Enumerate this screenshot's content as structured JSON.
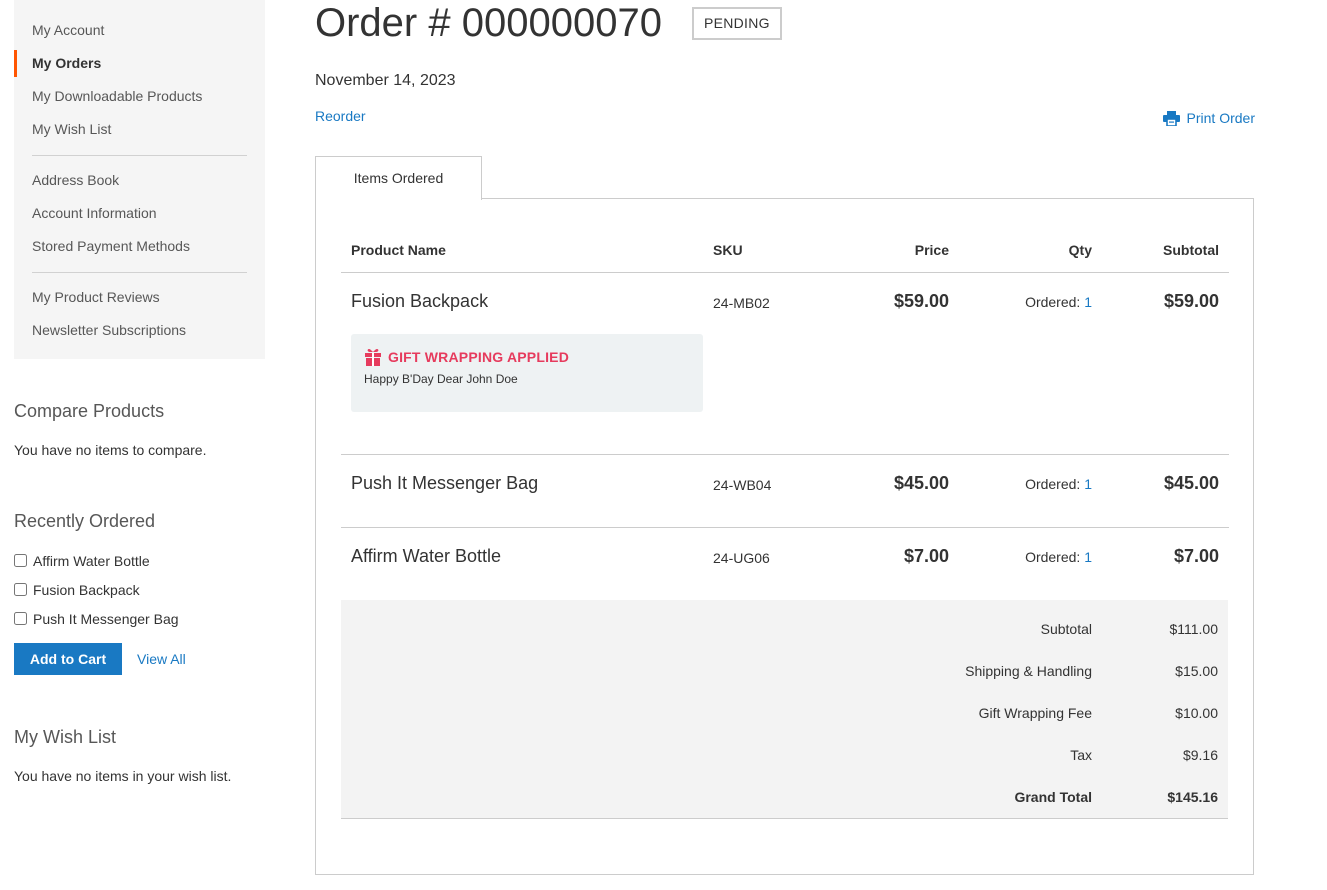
{
  "sidebar": {
    "nav": [
      {
        "label": "My Account"
      },
      {
        "label": "My Orders"
      },
      {
        "label": "My Downloadable Products"
      },
      {
        "label": "My Wish List"
      },
      {
        "label": "Address Book"
      },
      {
        "label": "Account Information"
      },
      {
        "label": "Stored Payment Methods"
      },
      {
        "label": "My Product Reviews"
      },
      {
        "label": "Newsletter Subscriptions"
      }
    ],
    "current_item": "My Orders",
    "accent_color": "#ff5501",
    "compare": {
      "title": "Compare Products",
      "empty_text": "You have no items to compare."
    },
    "recently_ordered": {
      "title": "Recently Ordered",
      "items": [
        "Affirm Water Bottle",
        "Fusion Backpack",
        "Push It Messenger Bag"
      ],
      "add_to_cart": "Add to Cart",
      "view_all": "View All"
    },
    "wishlist": {
      "title": "My Wish List",
      "empty_text": "You have no items in your wish list."
    }
  },
  "order": {
    "title": "Order # 000000070",
    "status": "PENDING",
    "date": "November 14, 2023",
    "reorder": "Reorder",
    "print": "Print Order",
    "tab": "Items Ordered",
    "columns": {
      "name": "Product Name",
      "sku": "SKU",
      "price": "Price",
      "qty": "Qty",
      "subtotal": "Subtotal"
    },
    "items": [
      {
        "name": "Fusion Backpack",
        "sku": "24-MB02",
        "price": "$59.00",
        "qty_label": "Ordered:",
        "qty": "1",
        "subtotal": "$59.00",
        "gift": {
          "title": "GIFT WRAPPING APPLIED",
          "message": "Happy B'Day Dear John Doe"
        }
      },
      {
        "name": "Push It Messenger Bag",
        "sku": "24-WB04",
        "price": "$45.00",
        "qty_label": "Ordered:",
        "qty": "1",
        "subtotal": "$45.00"
      },
      {
        "name": "Affirm Water Bottle",
        "sku": "24-UG06",
        "price": "$7.00",
        "qty_label": "Ordered:",
        "qty": "1",
        "subtotal": "$7.00"
      }
    ],
    "totals": [
      {
        "label": "Subtotal",
        "value": "$111.00"
      },
      {
        "label": "Shipping & Handling",
        "value": "$15.00"
      },
      {
        "label": "Gift Wrapping Fee",
        "value": "$10.00"
      },
      {
        "label": "Tax",
        "value": "$9.16"
      },
      {
        "label": "Grand Total",
        "value": "$145.16"
      }
    ]
  },
  "colors": {
    "link": "#1979c3",
    "gift": "#e63b5d",
    "button": "#1979c3"
  }
}
